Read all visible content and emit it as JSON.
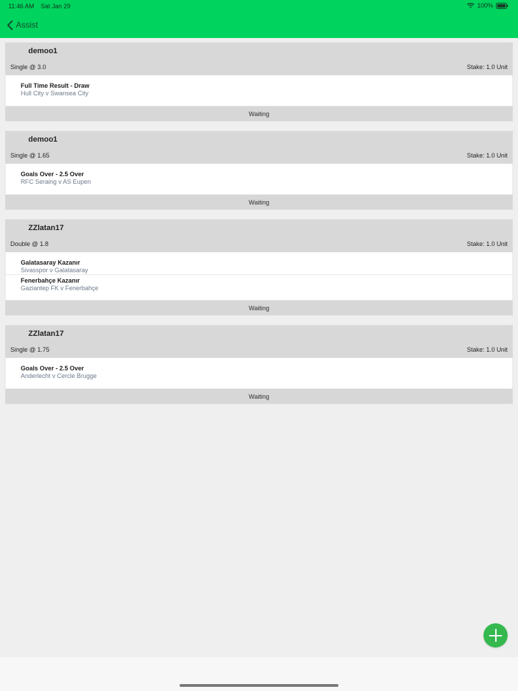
{
  "status_bar": {
    "time": "11:46 AM",
    "date": "Sat Jan 29",
    "battery": "100%"
  },
  "nav": {
    "back_label": "Assist"
  },
  "bets": [
    {
      "user": "demoo1",
      "bet_type": "Single @ 3.0",
      "stake": "Stake: 1.0 Unit",
      "selections": [
        {
          "market": "Full Time Result - Draw",
          "event": "Hull City v Swansea City"
        }
      ],
      "status": "Waiting"
    },
    {
      "user": "demoo1",
      "bet_type": "Single @ 1.65",
      "stake": "Stake: 1.0 Unit",
      "selections": [
        {
          "market": "Goals Over - 2.5 Over",
          "event": "RFC Seraing v AS Eupen"
        }
      ],
      "status": "Waiting"
    },
    {
      "user": "ZZlatan17",
      "bet_type": "Double @ 1.8",
      "stake": "Stake: 1.0 Unit",
      "selections": [
        {
          "market": "Galatasaray Kazanır",
          "event": "Sivasspor v Galatasaray"
        },
        {
          "market": "Fenerbahçe Kazanır",
          "event": "Gaziantep FK v Fenerbahçe"
        }
      ],
      "status": "Waiting"
    },
    {
      "user": "ZZlatan17",
      "bet_type": "Single @ 1.75",
      "stake": "Stake: 1.0 Unit",
      "selections": [
        {
          "market": "Goals Over - 2.5 Over",
          "event": "Anderlecht v Cercle Brugge"
        }
      ],
      "status": "Waiting"
    }
  ],
  "colors": {
    "topbar": "#00d45e",
    "card_header": "#d8d8d8",
    "fab": "#35b94e"
  },
  "icons": {
    "back": "chevron-left-icon",
    "wifi": "wifi-icon",
    "battery": "battery-icon",
    "fab": "plus-icon"
  }
}
